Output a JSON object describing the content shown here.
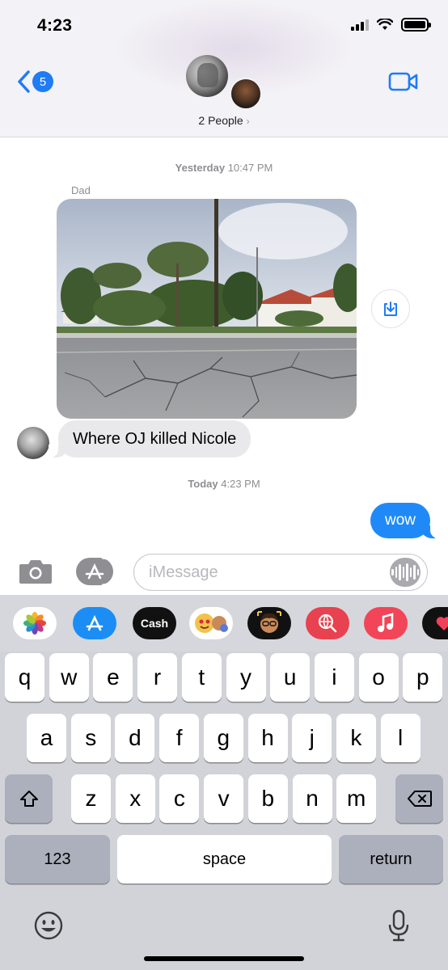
{
  "status_bar": {
    "time": "4:23"
  },
  "header": {
    "back_badge": "5",
    "people_label": "2 People",
    "people_chevron": "›"
  },
  "conversation": {
    "timestamp_yesterday_day": "Yesterday",
    "timestamp_yesterday_time": "10:47 PM",
    "sender": "Dad",
    "incoming_text": "Where OJ killed Nicole",
    "timestamp_today_day": "Today",
    "timestamp_today_time": "4:23 PM",
    "outgoing_text": "wow"
  },
  "composer": {
    "placeholder": "iMessage"
  },
  "app_strip": {
    "items": [
      "photos-icon",
      "app-store-icon",
      "apple-cash-icon",
      "memoji-stickers-icon",
      "memoji-icon",
      "search-images-icon",
      "music-icon",
      "digital-touch-icon"
    ],
    "cash_label": "Cash",
    "cash_symbol": ""
  },
  "keyboard": {
    "row1": [
      "q",
      "w",
      "e",
      "r",
      "t",
      "y",
      "u",
      "i",
      "o",
      "p"
    ],
    "row2": [
      "a",
      "s",
      "d",
      "f",
      "g",
      "h",
      "j",
      "k",
      "l"
    ],
    "row3": [
      "z",
      "x",
      "c",
      "v",
      "b",
      "n",
      "m"
    ],
    "numbers_label": "123",
    "space_label": "space",
    "return_label": "return"
  },
  "colors": {
    "accent": "#1f8af7",
    "incoming_bubble": "#e9e9eb",
    "keyboard_bg": "#d1d3d9"
  }
}
